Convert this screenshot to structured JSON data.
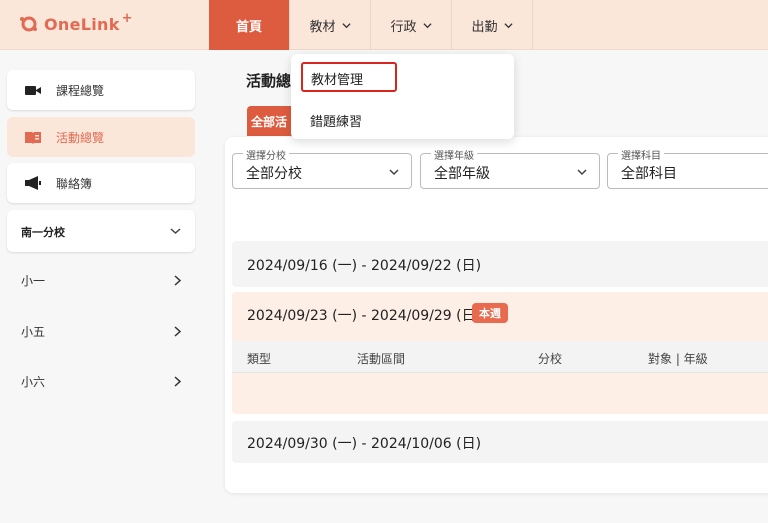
{
  "brand": {
    "name": "OneLink",
    "plus": "+",
    "color": "#e26a52"
  },
  "nav": {
    "items": [
      {
        "label": "首頁",
        "active": true
      },
      {
        "label": "教材",
        "dropdown": true
      },
      {
        "label": "行政",
        "dropdown": true
      },
      {
        "label": "出勤",
        "dropdown": true
      }
    ]
  },
  "dropdown": {
    "items": [
      {
        "label": "教材管理",
        "selected": true
      },
      {
        "label": "錯題練習"
      }
    ]
  },
  "sidebar": {
    "menu": [
      {
        "label": "課程總覽",
        "icon": "video-camera-icon"
      },
      {
        "label": "活動總覽",
        "icon": "book-icon",
        "active": true
      },
      {
        "label": "聯絡簿",
        "icon": "megaphone-icon"
      }
    ],
    "branch": {
      "label": "南一分校"
    },
    "grades": [
      {
        "label": "小一"
      },
      {
        "label": "小五"
      },
      {
        "label": "小六"
      }
    ]
  },
  "main": {
    "title": "活動總",
    "tab_all": "全部活",
    "filters": [
      {
        "legend": "選擇分校",
        "value": "全部分校"
      },
      {
        "legend": "選擇年級",
        "value": "全部年級"
      },
      {
        "legend": "選擇科目",
        "value": "全部科目"
      }
    ],
    "weeks": [
      {
        "range": "2024/09/16 (一) - 2024/09/22 (日)"
      },
      {
        "range": "2024/09/23 (一) - 2024/09/29 (日)",
        "badge": "本週",
        "current": true
      },
      {
        "range": "2024/09/30 (一) - 2024/10/06 (日)"
      }
    ],
    "table_headers": [
      "類型",
      "活動區間",
      "分校",
      "對象 | 年級"
    ]
  },
  "colors": {
    "accent": "#dd5b3f",
    "topbar": "#fbe6da",
    "highlight": "#d9251d"
  }
}
